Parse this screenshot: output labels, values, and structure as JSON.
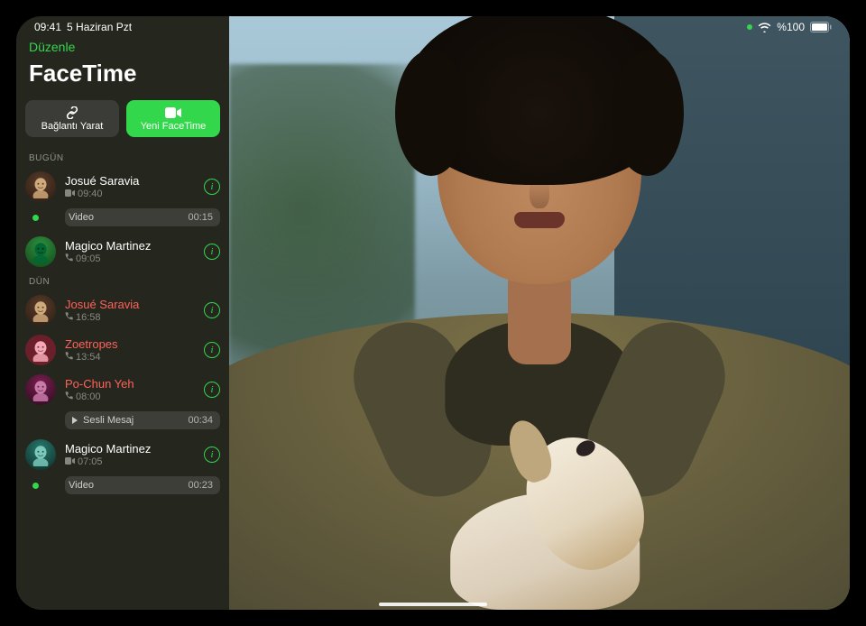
{
  "status": {
    "time": "09:41",
    "date": "5 Haziran Pzt",
    "battery_text": "%100"
  },
  "sidebar": {
    "edit_label": "Düzenle",
    "app_title": "FaceTime",
    "create_link_label": "Bağlantı Yarat",
    "new_facetime_label": "Yeni FaceTime"
  },
  "sections": [
    {
      "label": "BUGÜN",
      "items": [
        {
          "name": "Josué Saravia",
          "missed": false,
          "meta_icon": "video",
          "meta_time": "09:40",
          "avatar": "a",
          "attachment": {
            "kind": "video",
            "label": "Video",
            "time": "00:15",
            "unread": true
          }
        },
        {
          "name": "Magico Martinez",
          "missed": false,
          "meta_icon": "phone",
          "meta_time": "09:05",
          "avatar": "b"
        }
      ]
    },
    {
      "label": "DÜN",
      "items": [
        {
          "name": "Josué Saravia",
          "missed": true,
          "meta_icon": "phone",
          "meta_time": "16:58",
          "avatar": "a"
        },
        {
          "name": "Zoetropes",
          "missed": true,
          "meta_icon": "phone",
          "meta_time": "13:54",
          "avatar": "c"
        },
        {
          "name": "Po-Chun Yeh",
          "missed": true,
          "meta_icon": "phone",
          "meta_time": "08:00",
          "avatar": "d",
          "attachment": {
            "kind": "voice",
            "label": "Sesli Mesaj",
            "time": "00:34",
            "unread": false
          }
        },
        {
          "name": "Magico Martinez",
          "missed": false,
          "meta_icon": "video",
          "meta_time": "07:05",
          "avatar": "e",
          "attachment": {
            "kind": "video",
            "label": "Video",
            "time": "00:23",
            "unread": true
          }
        }
      ]
    }
  ],
  "icons": {
    "info_glyph": "i"
  }
}
